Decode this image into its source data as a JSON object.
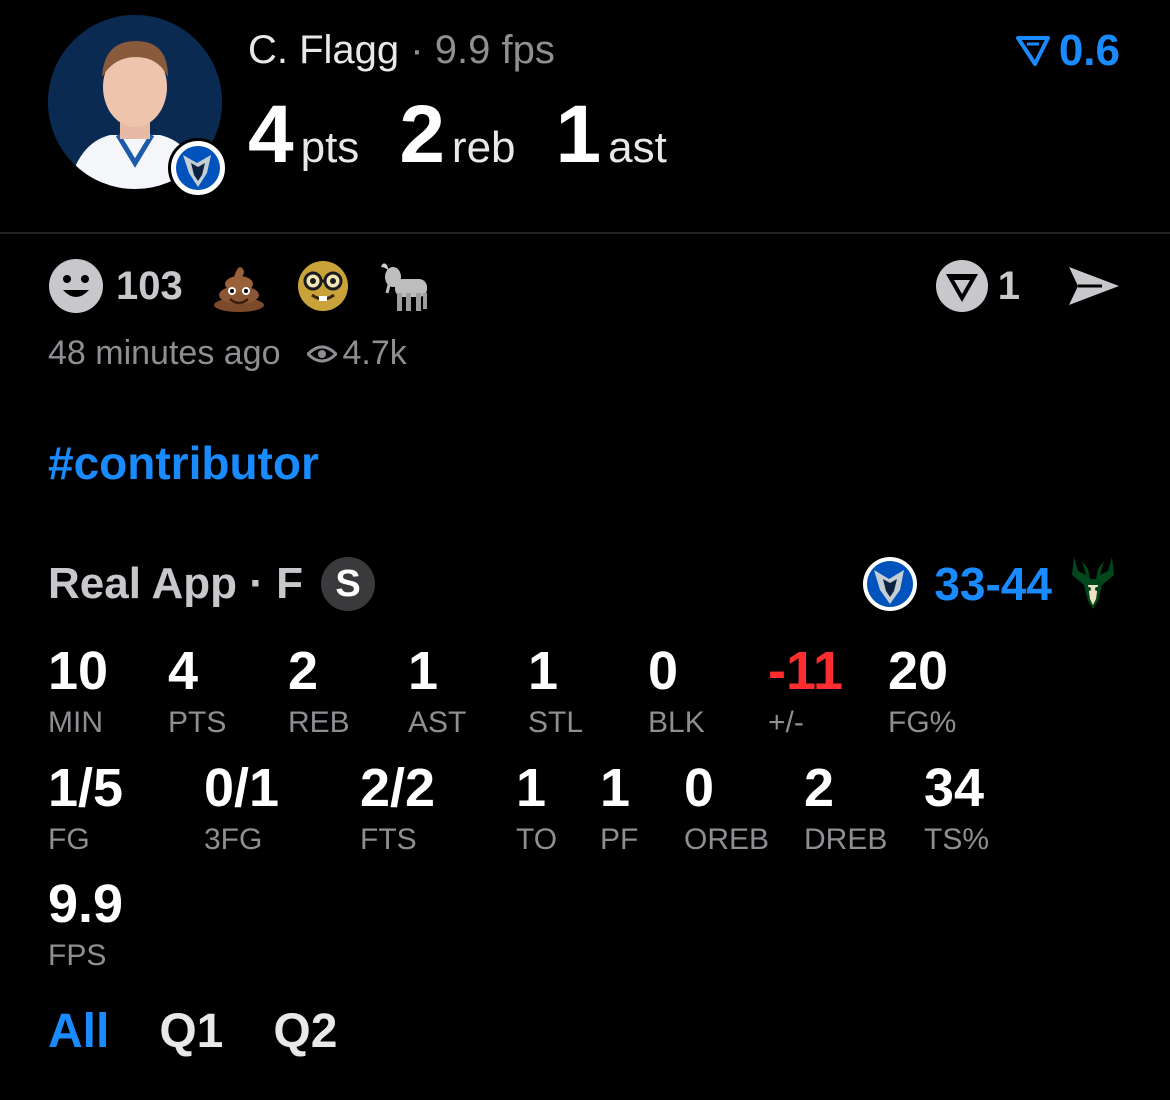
{
  "player": {
    "name": "C. Flagg",
    "separator": "·",
    "fps_text": "9.9 fps",
    "pts": "4",
    "pts_label": "pts",
    "reb": "2",
    "reb_label": "reb",
    "ast": "1",
    "ast_label": "ast"
  },
  "boost": {
    "value": "0.6",
    "icon": "boost-icon",
    "color": "#1a8bff"
  },
  "reactions": {
    "smiley_count": "103",
    "emojis": [
      "poop-emoji",
      "nerd-emoji",
      "goat-emoji"
    ],
    "share_count": "1"
  },
  "meta": {
    "time_ago": "48 minutes ago",
    "views": "4.7k"
  },
  "hashtag": "#contributor",
  "game": {
    "source": "Real App",
    "position": "F",
    "badge": "S",
    "score": "33-44",
    "home_logo": "mavericks-logo",
    "away_logo": "bucks-logo"
  },
  "stats_row1": [
    {
      "value": "10",
      "label": "MIN"
    },
    {
      "value": "4",
      "label": "PTS"
    },
    {
      "value": "2",
      "label": "REB"
    },
    {
      "value": "1",
      "label": "AST"
    },
    {
      "value": "1",
      "label": "STL"
    },
    {
      "value": "0",
      "label": "BLK"
    },
    {
      "value": "-11",
      "label": "+/-"
    },
    {
      "value": "20",
      "label": "FG%"
    }
  ],
  "stats_row2": [
    {
      "value": "1/5",
      "label": "FG"
    },
    {
      "value": "0/1",
      "label": "3FG"
    },
    {
      "value": "2/2",
      "label": "FTS"
    },
    {
      "value": "1",
      "label": "TO"
    },
    {
      "value": "1",
      "label": "PF"
    },
    {
      "value": "0",
      "label": "OREB"
    },
    {
      "value": "2",
      "label": "DREB"
    },
    {
      "value": "34",
      "label": "TS%"
    }
  ],
  "stats_row3": [
    {
      "value": "9.9",
      "label": "FPS"
    }
  ],
  "tabs": [
    "All",
    "Q1",
    "Q2"
  ],
  "colors": {
    "accent": "#1a8bff",
    "negative": "#ff2d2d",
    "muted": "#8e8e93"
  }
}
